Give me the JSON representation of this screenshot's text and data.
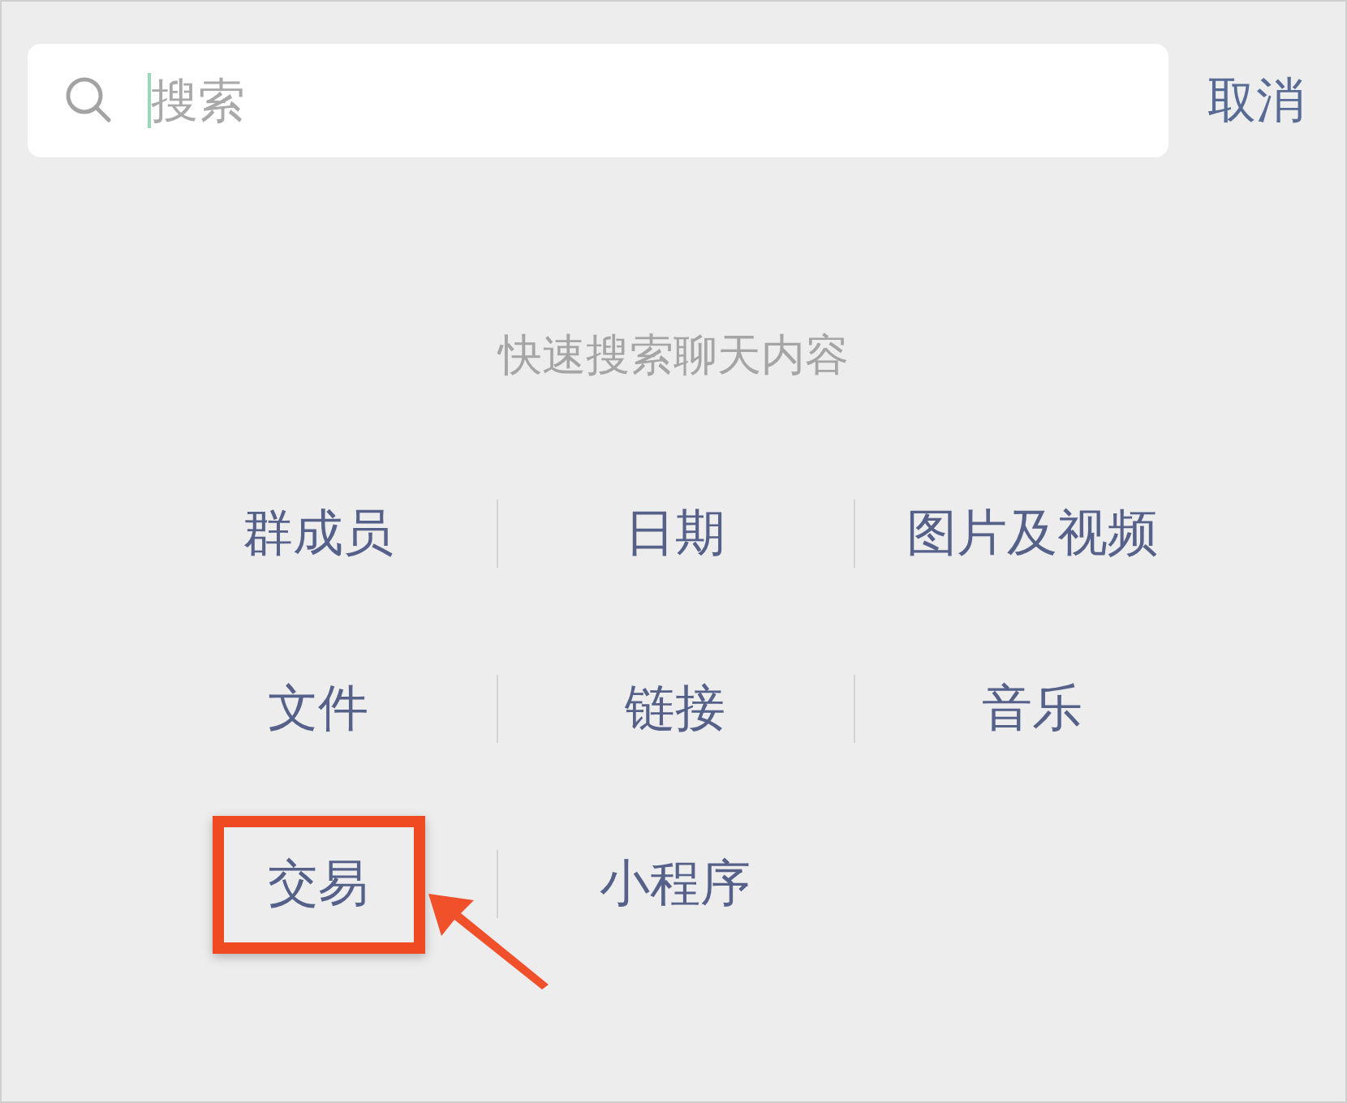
{
  "search": {
    "placeholder": "搜索"
  },
  "cancel": "取消",
  "hint": "快速搜索聊天内容",
  "categories": [
    {
      "label": "群成员",
      "highlighted": false
    },
    {
      "label": "日期",
      "highlighted": false
    },
    {
      "label": "图片及视频",
      "highlighted": false
    },
    {
      "label": "文件",
      "highlighted": false
    },
    {
      "label": "链接",
      "highlighted": false
    },
    {
      "label": "音乐",
      "highlighted": false
    },
    {
      "label": "交易",
      "highlighted": true
    },
    {
      "label": "小程序",
      "highlighted": false
    }
  ]
}
